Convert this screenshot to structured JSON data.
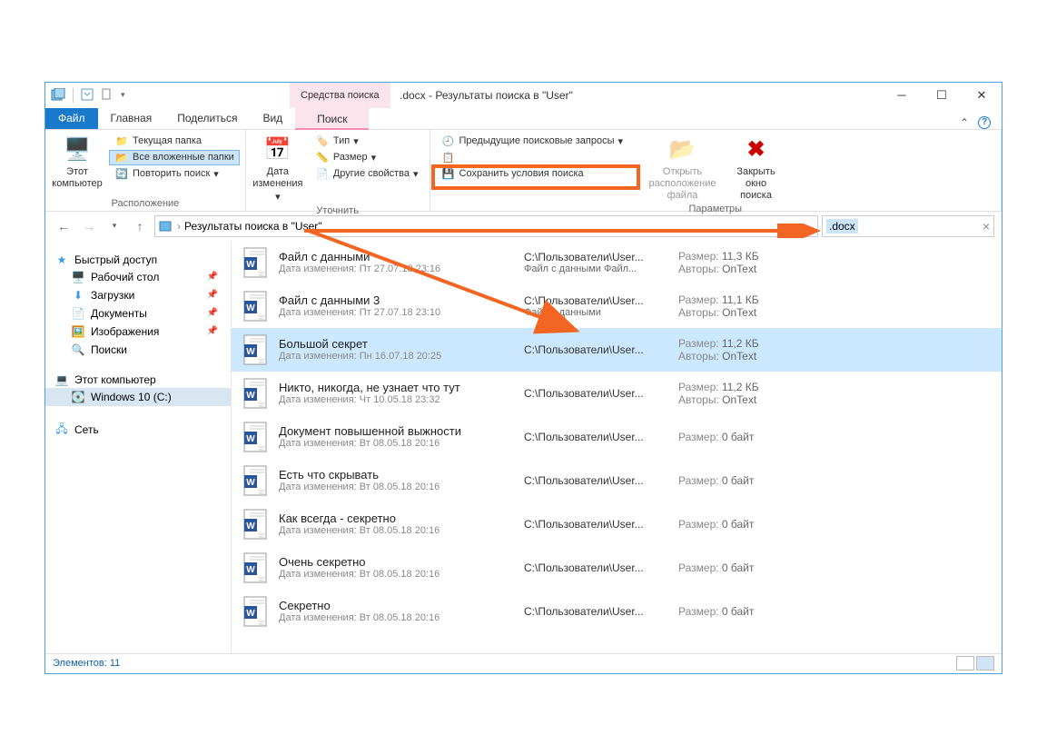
{
  "titlebar": {
    "search_tools_label": "Средства поиска",
    "title": ".docx - Результаты поиска в \"User\""
  },
  "menu": {
    "file": "Файл",
    "tabs": [
      "Главная",
      "Поделиться",
      "Вид"
    ],
    "search": "Поиск"
  },
  "ribbon": {
    "location": {
      "this_pc": "Этот компьютер",
      "current_folder": "Текущая папка",
      "all_subfolders": "Все вложенные папки",
      "search_again": "Повторить поиск",
      "group_label": "Расположение"
    },
    "refine": {
      "date": "Дата изменения",
      "type": "Тип",
      "size": "Размер",
      "other": "Другие свойства",
      "group_label": "Уточнить"
    },
    "options": {
      "prev_queries": "Предыдущие поисковые запросы",
      "save_search": "Сохранить условия поиска",
      "open_location": "Открыть расположение файла",
      "close_search": "Закрыть окно поиска",
      "group_label": "Параметры"
    }
  },
  "address": {
    "breadcrumb_label": "Результаты поиска в \"User\"",
    "search_query": ".docx"
  },
  "sidebar": {
    "quick_access": "Быстрый доступ",
    "items": [
      {
        "label": "Рабочий стол",
        "icon": "desktop"
      },
      {
        "label": "Загрузки",
        "icon": "downloads"
      },
      {
        "label": "Документы",
        "icon": "documents"
      },
      {
        "label": "Изображения",
        "icon": "pictures"
      },
      {
        "label": "Поиски",
        "icon": "search"
      }
    ],
    "this_pc": "Этот компьютер",
    "drive": "Windows 10 (C:)",
    "network": "Сеть"
  },
  "files": [
    {
      "title": "Файл с данными",
      "date": "Пт 27.07.18 23:16",
      "path": "C:\\Пользователи\\User...",
      "desc": "Файл с данными Файл...",
      "size": "11,3 КБ",
      "author": "OnText"
    },
    {
      "title": "Файл с данными 3",
      "date": "Пт 27.07.18 23:10",
      "path": "C:\\Пользователи\\User...",
      "desc": "Файл с данными",
      "size": "11,1 КБ",
      "author": "OnText"
    },
    {
      "title": "Большой секрет",
      "date": "Пн 16.07.18 20:25",
      "path": "C:\\Пользователи\\User...",
      "desc": "",
      "size": "11,2 КБ",
      "author": "OnText",
      "selected": true
    },
    {
      "title": "Никто, никогда, не узнает что тут",
      "date": "Чт 10.05.18 23:32",
      "path": "C:\\Пользователи\\User...",
      "desc": "",
      "size": "11,2 КБ",
      "author": "OnText"
    },
    {
      "title": "Документ повышенной выжности",
      "date": "Вт 08.05.18 20:16",
      "path": "C:\\Пользователи\\User...",
      "desc": "",
      "size": "0 байт",
      "author": ""
    },
    {
      "title": "Есть что скрывать",
      "date": "Вт 08.05.18 20:16",
      "path": "C:\\Пользователи\\User...",
      "desc": "",
      "size": "0 байт",
      "author": ""
    },
    {
      "title": "Как всегда - секретно",
      "date": "Вт 08.05.18 20:16",
      "path": "C:\\Пользователи\\User...",
      "desc": "",
      "size": "0 байт",
      "author": ""
    },
    {
      "title": "Очень секретно",
      "date": "Вт 08.05.18 20:16",
      "path": "C:\\Пользователи\\User...",
      "desc": "",
      "size": "0 байт",
      "author": ""
    },
    {
      "title": "Секретно",
      "date": "Вт 08.05.18 20:16",
      "path": "C:\\Пользователи\\User...",
      "desc": "",
      "size": "0 байт",
      "author": ""
    }
  ],
  "labels": {
    "date_prefix": "Дата изменения:",
    "size_prefix": "Размер:",
    "author_prefix": "Авторы:"
  },
  "statusbar": {
    "items": "Элементов: 11"
  }
}
